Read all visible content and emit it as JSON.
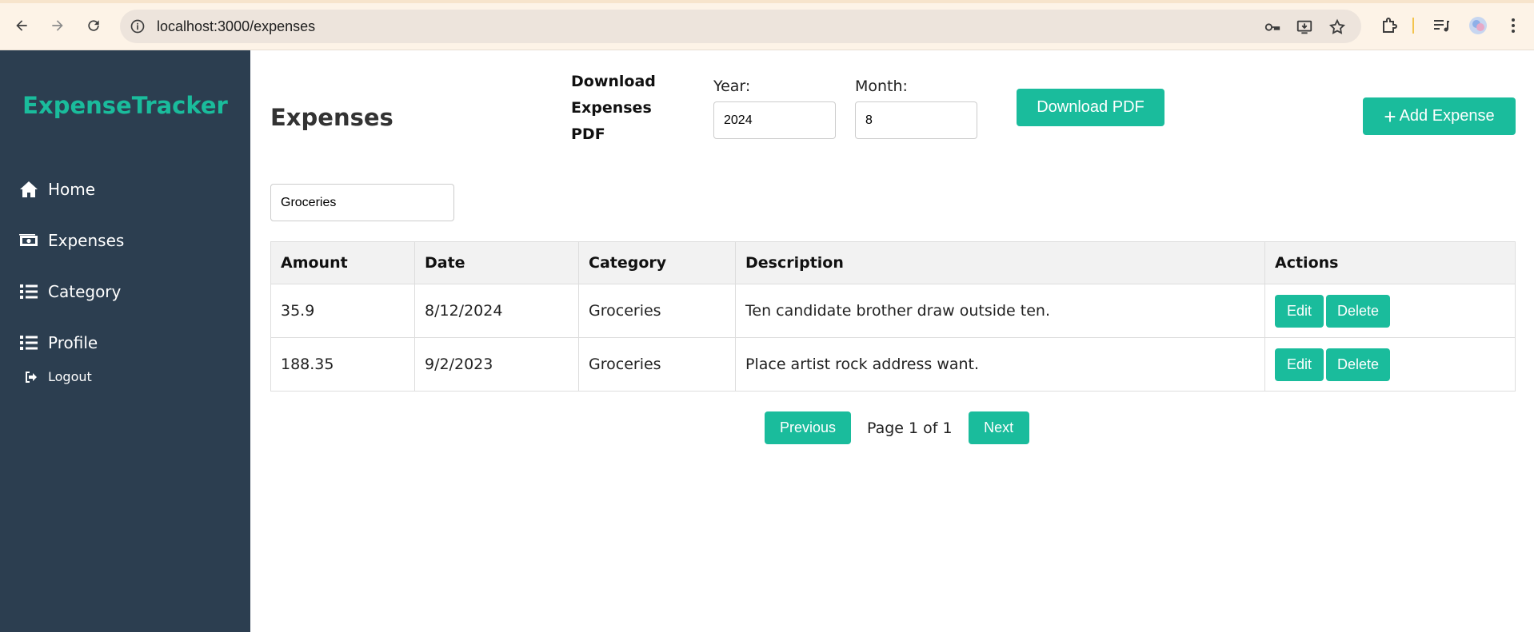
{
  "browser": {
    "url": "localhost:3000/expenses",
    "icons": [
      "back-icon",
      "forward-icon",
      "reload-icon",
      "info-icon",
      "password-key-icon",
      "install-app-icon",
      "bookmark-star-icon",
      "extensions-icon",
      "media-control-icon",
      "profile-avatar-icon",
      "menu-dots-icon"
    ]
  },
  "sidebar": {
    "brand": "ExpenseTracker",
    "items": [
      {
        "label": "Home",
        "icon": "home-icon"
      },
      {
        "label": "Expenses",
        "icon": "money-icon"
      },
      {
        "label": "Category",
        "icon": "list-icon"
      },
      {
        "label": "Profile",
        "icon": "list-icon"
      }
    ],
    "logout": {
      "label": "Logout",
      "icon": "sign-out-icon"
    }
  },
  "main": {
    "title": "Expenses",
    "download": {
      "label": "Download Expenses PDF",
      "year_label": "Year:",
      "year_value": "2024",
      "month_label": "Month:",
      "month_value": "8",
      "button": "Download PDF"
    },
    "add_button": "Add Expense",
    "search_value": "Groceries",
    "table": {
      "headers": [
        "Amount",
        "Date",
        "Category",
        "Description",
        "Actions"
      ],
      "rows": [
        {
          "amount": "35.9",
          "date": "8/12/2024",
          "category": "Groceries",
          "description": "Ten candidate brother draw outside ten.",
          "edit": "Edit",
          "delete": "Delete"
        },
        {
          "amount": "188.35",
          "date": "9/2/2023",
          "category": "Groceries",
          "description": "Place artist rock address want.",
          "edit": "Edit",
          "delete": "Delete"
        }
      ]
    },
    "pagination": {
      "previous": "Previous",
      "page_info": "Page 1 of 1",
      "next": "Next"
    }
  },
  "colors": {
    "accent": "#1abc9c",
    "sidebar_bg": "#2c3e50",
    "table_header_bg": "#f2f2f2"
  }
}
